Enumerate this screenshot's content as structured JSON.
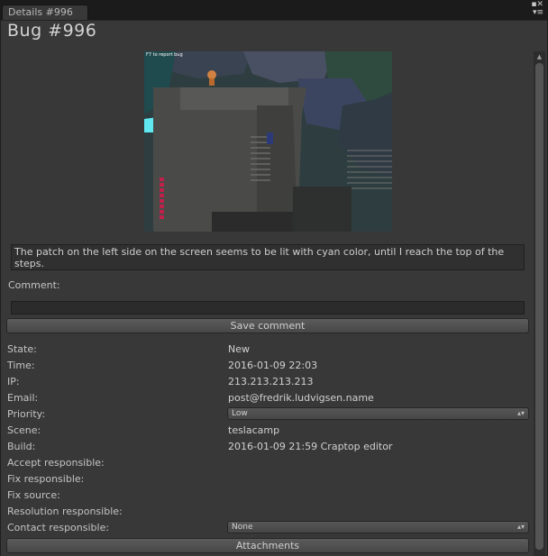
{
  "tab": {
    "label": "Details #996"
  },
  "title": "Bug #996",
  "screenshot": {
    "overlay_text": "F7 to report bug"
  },
  "description": "The patch on the left side on the screen seems to be lit with cyan color, until I reach the top of the steps.",
  "comment": {
    "label": "Comment:",
    "value": ""
  },
  "save_button": "Save comment",
  "fields": {
    "state": {
      "label": "State:",
      "value": "New"
    },
    "time": {
      "label": "Time:",
      "value": "2016-01-09 22:03"
    },
    "ip": {
      "label": "IP:",
      "value": "213.213.213.213"
    },
    "email": {
      "label": "Email:",
      "value": "post@fredrik.ludvigsen.name"
    },
    "priority": {
      "label": "Priority:",
      "value": "Low"
    },
    "scene": {
      "label": "Scene:",
      "value": "teslacamp"
    },
    "build": {
      "label": "Build:",
      "value": "2016-01-09 21:59 Craptop editor"
    },
    "accept_responsible": {
      "label": "Accept responsible:",
      "value": ""
    },
    "fix_responsible": {
      "label": "Fix responsible:",
      "value": ""
    },
    "fix_source": {
      "label": "Fix source:",
      "value": ""
    },
    "resolution_responsible": {
      "label": "Resolution responsible:",
      "value": ""
    },
    "contact_responsible": {
      "label": "Contact responsible:",
      "value": "None"
    }
  },
  "attachments_button": "Attachments",
  "icons": {
    "dropdown": "updown-arrows-icon",
    "window": "menu-icon"
  }
}
